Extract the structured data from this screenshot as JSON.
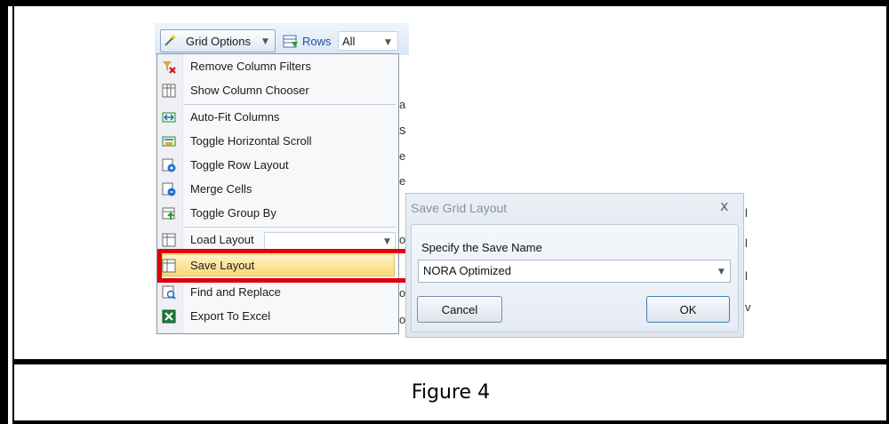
{
  "toolbar": {
    "grid_options_label": "Grid Options",
    "rows_label": "Rows",
    "rows_value": "All"
  },
  "menu": {
    "items": [
      {
        "label": "Remove Column Filters",
        "icon": "remove-filter-icon"
      },
      {
        "label": "Show Column Chooser",
        "icon": "column-chooser-icon"
      },
      {
        "label": "Auto-Fit Columns",
        "icon": "autofit-icon"
      },
      {
        "label": "Toggle Horizontal Scroll",
        "icon": "horizontal-scroll-icon"
      },
      {
        "label": "Toggle Row Layout",
        "icon": "row-layout-icon"
      },
      {
        "label": "Merge Cells",
        "icon": "merge-cells-icon"
      },
      {
        "label": "Toggle Group By",
        "icon": "group-by-icon"
      },
      {
        "label": "Load Layout",
        "icon": "load-layout-icon"
      },
      {
        "label": "Save Layout",
        "icon": "save-layout-icon"
      },
      {
        "label": "Find and Replace",
        "icon": "find-replace-icon"
      },
      {
        "label": "Export To Excel",
        "icon": "excel-icon"
      }
    ],
    "highlighted": "Save Layout"
  },
  "dialog": {
    "title": "Save Grid Layout",
    "prompt": "Specify the Save Name",
    "selected_name": "NORA Optimized",
    "cancel_label": "Cancel",
    "ok_label": "OK",
    "close_glyph": "x"
  },
  "caption": "Figure 4",
  "colors": {
    "highlight_box": "#e0000a",
    "menu_hover": "#f9d774"
  }
}
